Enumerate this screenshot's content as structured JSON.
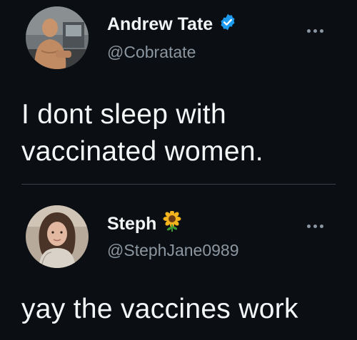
{
  "tweets": [
    {
      "display_name": "Andrew Tate",
      "handle": "@Cobratate",
      "verified": true,
      "text_lines": [
        "I dont sleep with",
        "vaccinated women."
      ],
      "avatar_icon": "man-photo-avatar",
      "badge_icon": "verified-badge-icon",
      "more_icon": "more-options-icon"
    },
    {
      "display_name": "Steph",
      "handle": "@StephJane0989",
      "verified": false,
      "name_emoji": "sunflower-icon",
      "text_lines": [
        "yay the vaccines work"
      ],
      "avatar_icon": "woman-photo-avatar",
      "more_icon": "more-options-icon"
    }
  ],
  "colors": {
    "background": "#0b0f14",
    "verified_blue": "#1d9bf0",
    "handle_gray": "#8b96a0",
    "text": "#f4f6f8"
  }
}
